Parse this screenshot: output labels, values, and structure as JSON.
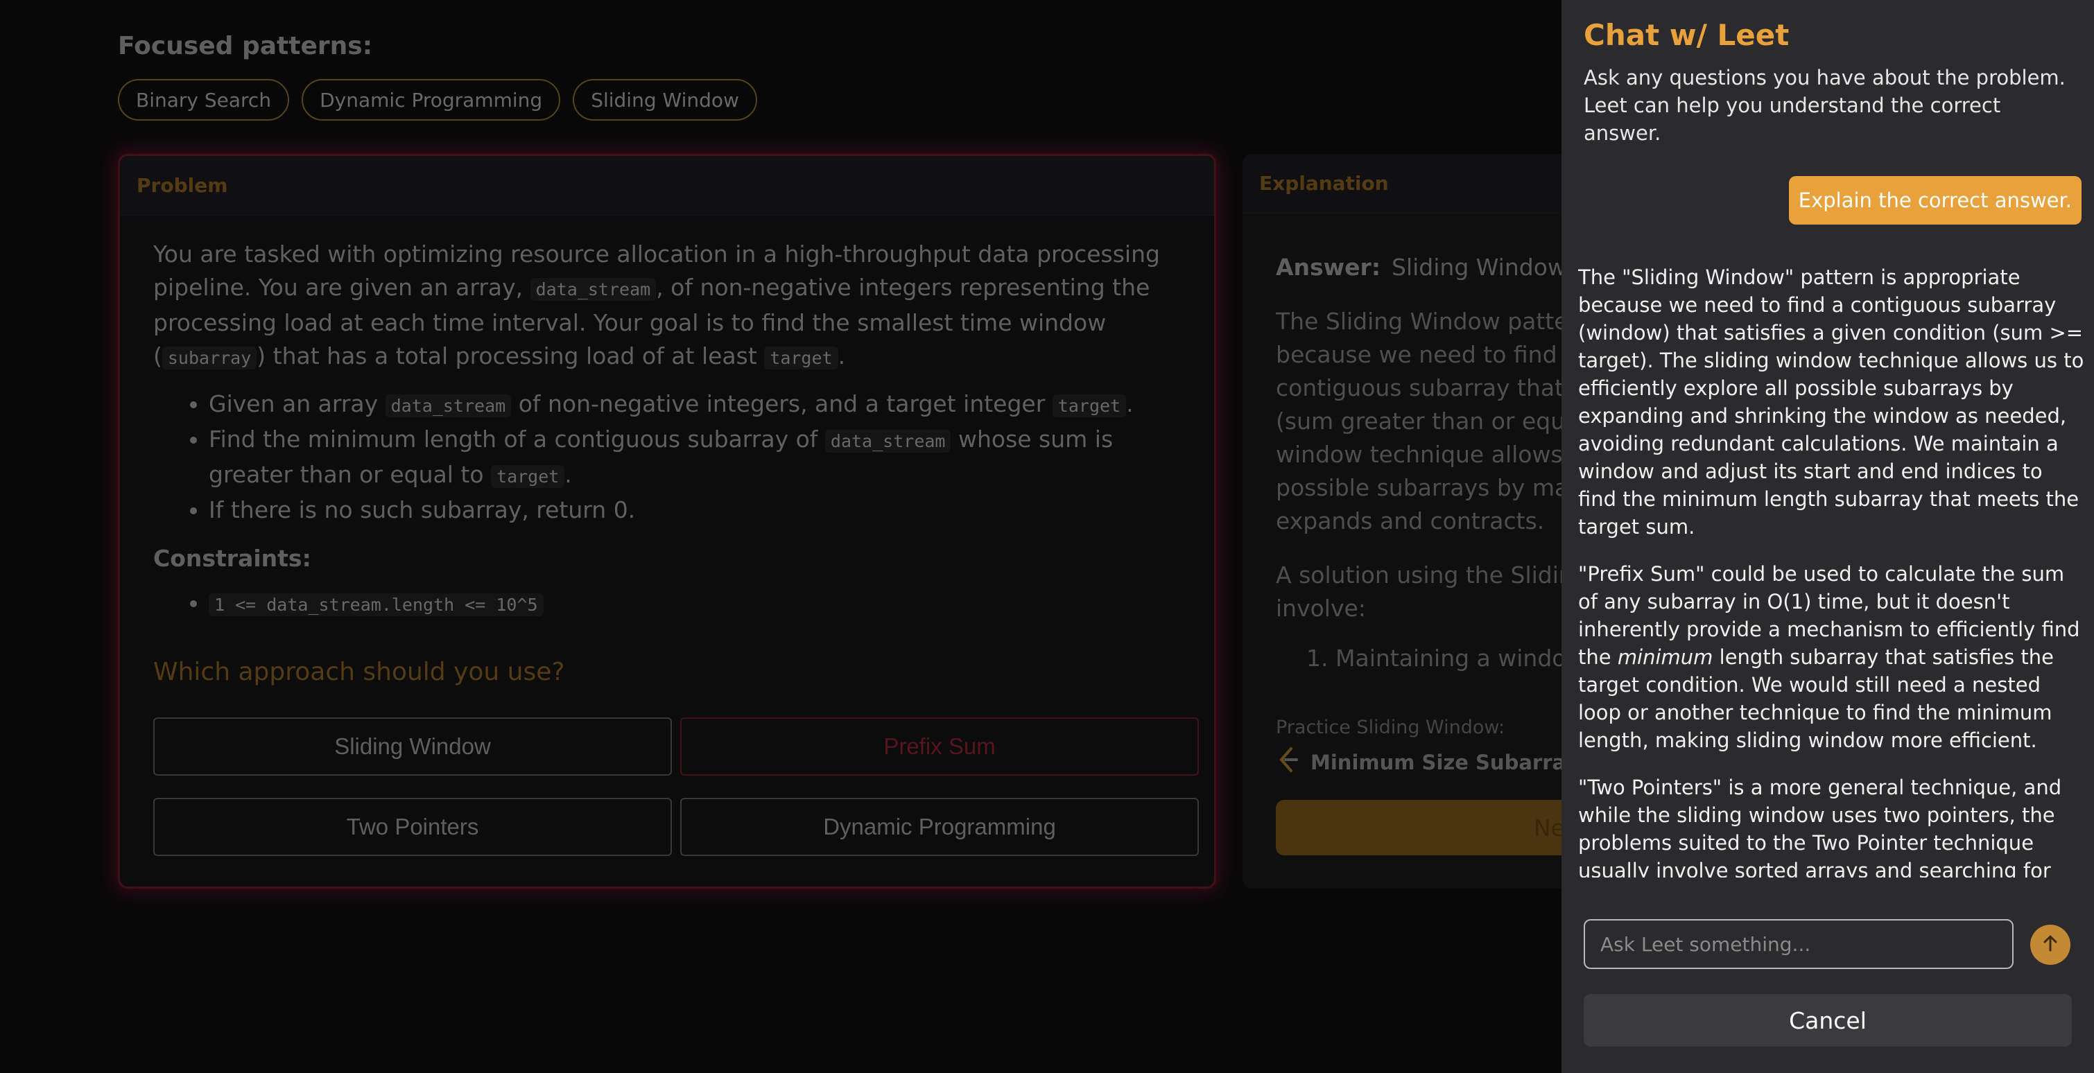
{
  "focused": {
    "title": "Focused patterns:",
    "chips": [
      "Binary Search",
      "Dynamic Programming",
      "Sliding Window"
    ]
  },
  "problem": {
    "header": "Problem",
    "p1_a": "You are tasked with optimizing resource allocation in a high-throughput data processing pipeline. You are given an array, ",
    "p1_code1": "data_stream",
    "p1_b": ", of non-negative integers representing the processing load at each time interval. Your goal is to find the smallest time window (",
    "p1_code2": "subarray",
    "p1_c": ") that has a total processing load of at least ",
    "p1_code3": "target",
    "p1_d": ".",
    "b1_a": "Given an array ",
    "b1_code1": "data_stream",
    "b1_b": " of non-negative integers, and a target integer ",
    "b1_code2": "target",
    "b1_c": ".",
    "b2_a": "Find the minimum length of a contiguous subarray of ",
    "b2_code1": "data_stream",
    "b2_b": " whose sum is greater than or equal to ",
    "b2_code2": "target",
    "b2_c": ".",
    "b3": "If there is no such subarray, return 0.",
    "constraints_label": "Constraints:",
    "constraint1": "1 <= data_stream.length <= 10^5",
    "question": "Which approach should you use?",
    "options": [
      "Sliding Window",
      "Prefix Sum",
      "Two Pointers",
      "Dynamic Programming"
    ],
    "selected_wrong": "Prefix Sum"
  },
  "explanation": {
    "header": "Explanation",
    "answer_label": "Answer:",
    "answer_value": "Sliding Window",
    "lines1": [
      "The Sliding Window patter",
      "because we need to find t",
      "contiguous subarray that",
      "(sum greater than or equa",
      "window technique allows",
      "possible subarrays by ma",
      "expands and contracts."
    ],
    "lines2": [
      "A solution using the Sliding",
      "involve:"
    ],
    "step1_num": "1.",
    "step1": "Maintaining a windo",
    "practice_label": "Practice Sliding Window:",
    "practice_link": "Minimum Size Subarray S",
    "next_label": "Ne"
  },
  "chat": {
    "title": "Chat w/ Leet",
    "subtitle": "Ask any questions you have about the problem. Leet can help you understand the correct answer.",
    "user_message": "Explain the correct answer.",
    "reply_p1": "The \"Sliding Window\" pattern is appropriate because we need to find a contiguous subarray (window) that satisfies a given condition (sum >= target). The sliding window technique allows us to efficiently explore all possible subarrays by expanding and shrinking the window as needed, avoiding redundant calculations. We maintain a window and adjust its start and end indices to find the minimum length subarray that meets the target sum.",
    "reply_p2_a": "\"Prefix Sum\" could be used to calculate the sum of any subarray in O(1) time, but it doesn't inherently provide a mechanism to efficiently find the ",
    "reply_p2_em": "minimum",
    "reply_p2_b": " length subarray that satisfies the target condition. We would still need a nested loop or another technique to find the minimum length, making sliding window more efficient.",
    "reply_p3": "\"Two Pointers\" is a more general technique, and while the sliding window uses two pointers, the problems suited to the Two Pointer technique usually involve sorted arrays and searching for",
    "input_placeholder": "Ask Leet something...",
    "cancel_label": "Cancel"
  },
  "colors": {
    "accent": "#e9a23b",
    "wrong": "#8b2232",
    "panel_bg": "#2b2b2d",
    "page_bg": "#0d0d0f"
  }
}
